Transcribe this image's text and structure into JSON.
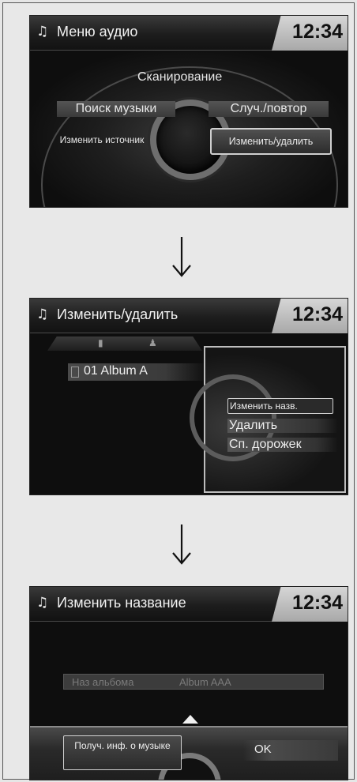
{
  "screens": [
    {
      "title": "Меню аудио",
      "clock": "12:34",
      "menu": {
        "scan": "Сканирование",
        "search_music": "Поиск музыки",
        "shuffle_repeat": "Случ./повтор",
        "change_source": "Изменить источник",
        "edit_delete": "Изменить/удалить"
      }
    },
    {
      "title": "Изменить/удалить",
      "clock": "12:34",
      "album": "01 Album A",
      "options": [
        "Изменить назв.",
        "Удалить",
        "Сп. дорожек"
      ]
    },
    {
      "title": "Изменить название",
      "clock": "12:34",
      "field_label": "Наз альбома",
      "field_value": "Album AAA",
      "info_button": "Получ. инф. о музыке",
      "ok_button": "OK"
    }
  ],
  "icons": {
    "music_note": "music-note-icon",
    "arrow": "arrow-down-icon"
  },
  "colors": {
    "screen_bg": "#0d0d0d",
    "clock_tab": "#c0c0c0",
    "highlight_border": "#d0d0d0"
  }
}
